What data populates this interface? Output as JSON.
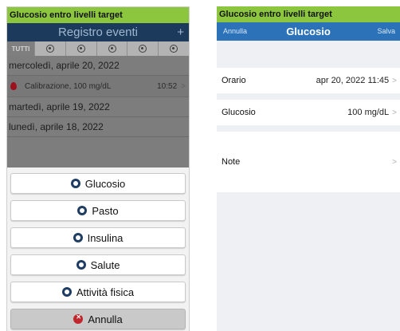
{
  "left_screen": {
    "banner": "Glucosio entro livelli target",
    "navbar": {
      "title": "Registro eventi",
      "add": "+"
    },
    "filters": [
      {
        "label": "TUTTI",
        "active": true,
        "icon": ""
      },
      {
        "label": "",
        "active": false,
        "icon": "glucose-filter-icon"
      },
      {
        "label": "",
        "active": false,
        "icon": "meal-filter-icon"
      },
      {
        "label": "",
        "active": false,
        "icon": "insulin-filter-icon"
      },
      {
        "label": "",
        "active": false,
        "icon": "health-filter-icon"
      },
      {
        "label": "",
        "active": false,
        "icon": "exercise-filter-icon"
      }
    ],
    "days": {
      "d1": "mercoledì, aprile 20, 2022",
      "d2": "martedì, aprile 19, 2022",
      "d3": "lunedì, aprile 18, 2022"
    },
    "event": {
      "label": "Calibrazione, 100 mg/dL",
      "time": "10:52",
      "icon": "blood-drop-icon"
    },
    "action_sheet": {
      "glucose": "Glucosio",
      "meal": "Pasto",
      "insulin": "Insulina",
      "health": "Salute",
      "exercise": "Attività fisica",
      "cancel": "Annulla"
    }
  },
  "right_screen": {
    "banner": "Glucosio entro livelli target",
    "navbar": {
      "cancel": "Annulla",
      "title": "Glucosio",
      "save": "Salva"
    },
    "fields": {
      "time_label": "Orario",
      "time_value": "apr 20, 2022 11:45",
      "glucose_label": "Glucosio",
      "glucose_value": "100 mg/dL",
      "notes_label": "Note"
    }
  },
  "colors": {
    "banner": "#8cc63f",
    "left_navbar": "#1c3a5c",
    "right_navbar": "#2b72b9",
    "cancel_icon": "#c0262d"
  }
}
